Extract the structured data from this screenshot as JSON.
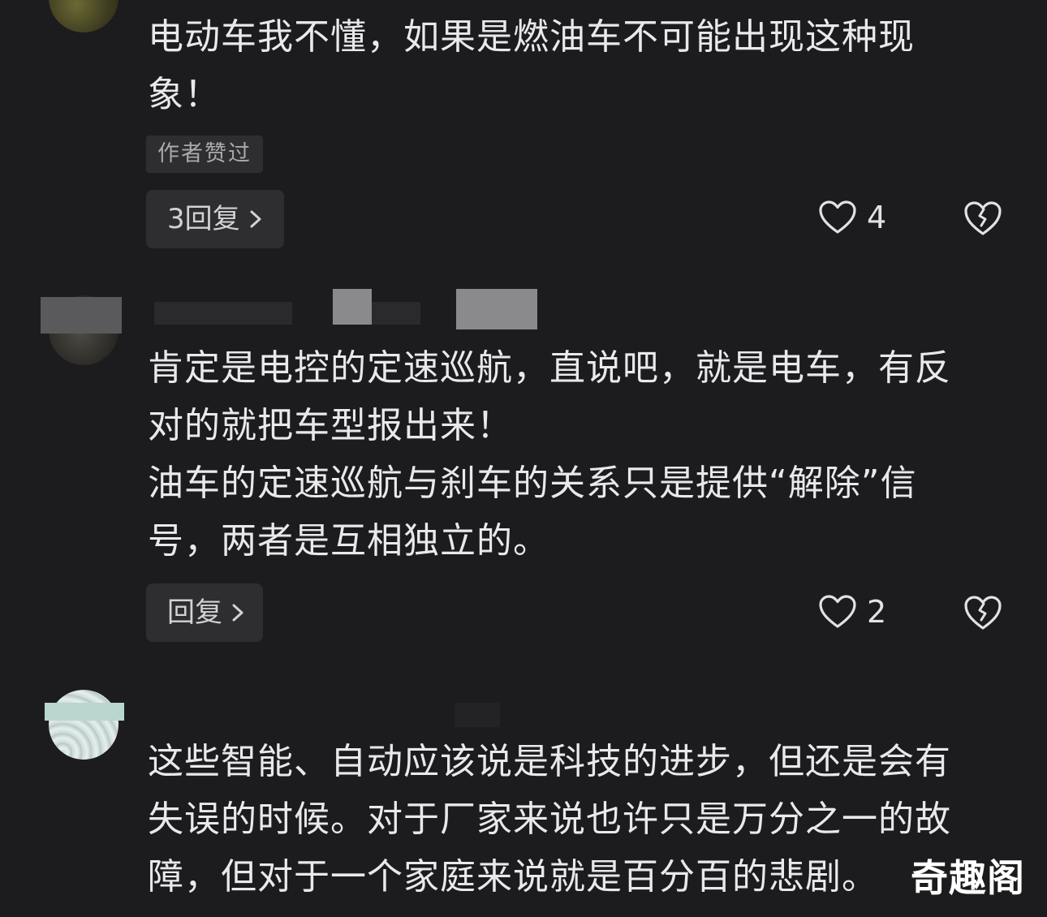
{
  "comments": [
    {
      "text_lines": [
        "电动车我不懂，如果是燃油车不可能出现这种现",
        "象！"
      ],
      "author_liked_label": "作者赞过",
      "reply_label": "3回复",
      "like_count": "4"
    },
    {
      "text_lines": [
        "肯定是电控的定速巡航，直说吧，就是电车，有反",
        "对的就把车型报出来！",
        "油车的定速巡航与刹车的关系只是提供“解除”信",
        "号，两者是互相独立的。"
      ],
      "reply_label": "回复",
      "like_count": "2"
    },
    {
      "text_lines": [
        "这些智能、自动应该说是科技的进步，但还是会有",
        "失误的时候。对于厂家来说也许只是万分之一的故",
        "障，但对于一个家庭来说就是百分百的悲剧。"
      ]
    }
  ],
  "watermark": "奇趣阁",
  "icons": {
    "like": "heart-outline-icon",
    "dislike": "broken-heart-icon",
    "chevron": "chevron-right-icon"
  },
  "colors": {
    "background": "#1c1c1e",
    "text": "#e9e9eb",
    "button_bg": "#2e2e31"
  }
}
